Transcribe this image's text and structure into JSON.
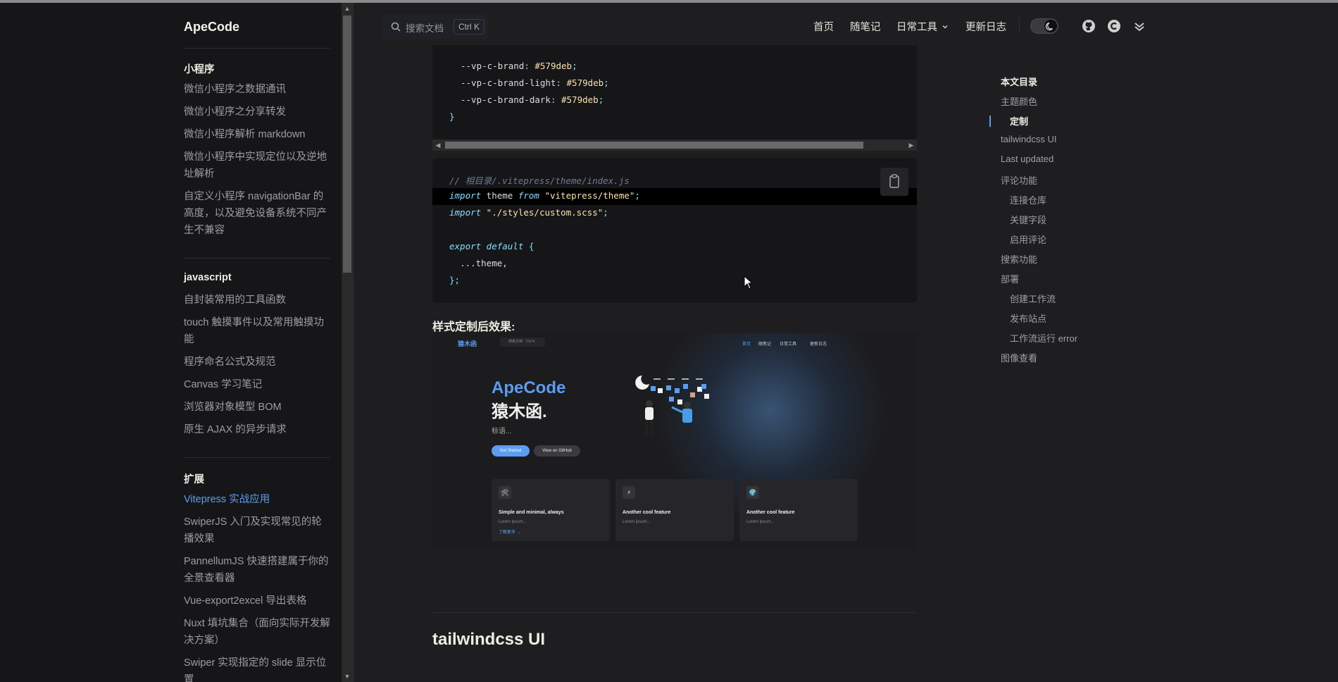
{
  "site": {
    "title": "ApeCode"
  },
  "sidebar": {
    "groups": [
      {
        "title": "小程序",
        "items": [
          "微信小程序之数据通讯",
          "微信小程序之分享转发",
          "微信小程序解析 markdown",
          "微信小程序中实现定位以及逆地址解析",
          "自定义小程序 navigationBar 的高度，以及避免设备系统不同产生不兼容"
        ]
      },
      {
        "title": "javascript",
        "items": [
          "自封装常用的工具函数",
          "touch 触摸事件以及常用触摸功能",
          "程序命名公式及规范",
          "Canvas 学习笔记",
          "浏览器对象模型 BOM",
          "原生 AJAX 的异步请求"
        ]
      },
      {
        "title": "扩展",
        "items": [
          "Vitepress 实战应用",
          "SwiperJS 入门及实现常见的轮播效果",
          "PannellumJS 快速搭建属于你的全景查看器",
          "Vue-export2excel 导出表格",
          "Nuxt 填坑集合（面向实际开发解决方案）",
          "Swiper 实现指定的 slide 显示位置"
        ]
      }
    ],
    "active_item": "Vitepress 实战应用"
  },
  "navbar": {
    "search_placeholder": "搜索文档",
    "search_shortcut": "Ctrl K",
    "items": [
      "首页",
      "随笔记",
      "日常工具",
      "更新日志"
    ],
    "dropdown_indicator": "chevron-down-icon",
    "icons": [
      "github-icon",
      "copyright-c-icon",
      "double-chevron-icon"
    ],
    "theme_toggle": "dark"
  },
  "code_block_1": {
    "lines": [
      {
        "prop": "--vp-c-brand",
        "value": "#579deb"
      },
      {
        "prop": "--vp-c-brand-light",
        "value": "#579deb"
      },
      {
        "prop": "--vp-c-brand-dark",
        "value": "#579deb"
      }
    ],
    "closing": "}"
  },
  "code_block_2": {
    "comment": "// 相目录/.vitepress/theme/index.js",
    "line1": {
      "kw1": "import",
      "id": " theme ",
      "kw2": "from",
      "str": " \"vitepress/theme\"",
      "end": ";"
    },
    "line2": {
      "kw1": "import",
      "str": " \"./styles/custom.scss\"",
      "end": ";"
    },
    "line3": {
      "kw1": "export",
      "kw2": " default",
      "punc": " {"
    },
    "line4": "  ...theme,",
    "line5": "};"
  },
  "content": {
    "result_title": "样式定制后效果:",
    "section_heading": "tailwindcss UI"
  },
  "preview": {
    "logo": "猿木函",
    "search": "搜索文档",
    "search_key": "Ctrl K",
    "nav": [
      "首页",
      "随笔记",
      "日常工具",
      "更新日志"
    ],
    "hero_name": "ApeCode",
    "hero_text": "猿木函.",
    "tagline": "标语...",
    "btn_primary": "Get Started",
    "btn_secondary": "View on GitHub",
    "features": [
      {
        "icon": "🛠",
        "title": "Simple and minimal, always",
        "desc": "Lorem ipsum...",
        "link": "了解更多 →"
      },
      {
        "icon": "⚡",
        "title": "Another cool feature",
        "desc": "Lorem ipsum..."
      },
      {
        "icon": "🌍",
        "title": "Another cool feature",
        "desc": "Lorem ipsum..."
      }
    ]
  },
  "toc": {
    "title": "本文目录",
    "items": [
      {
        "label": "主题颜色",
        "level": 1
      },
      {
        "label": "定制",
        "level": 2,
        "active": true
      },
      {
        "label": "tailwindcss UI",
        "level": 1
      },
      {
        "label": "Last updated",
        "level": 1
      },
      {
        "label": "评论功能",
        "level": 1
      },
      {
        "label": "连接仓库",
        "level": 2
      },
      {
        "label": "关键字段",
        "level": 2
      },
      {
        "label": "启用评论",
        "level": 2
      },
      {
        "label": "搜索功能",
        "level": 1
      },
      {
        "label": "部署",
        "level": 1
      },
      {
        "label": "创建工作流",
        "level": 2
      },
      {
        "label": "发布站点",
        "level": 2
      },
      {
        "label": "工作流运行 error",
        "level": 2
      },
      {
        "label": "图像查看",
        "level": 1
      }
    ]
  },
  "colors": {
    "brand": "#5b9df0",
    "bg": "#1e1e20",
    "sidebar_bg": "#161618"
  }
}
